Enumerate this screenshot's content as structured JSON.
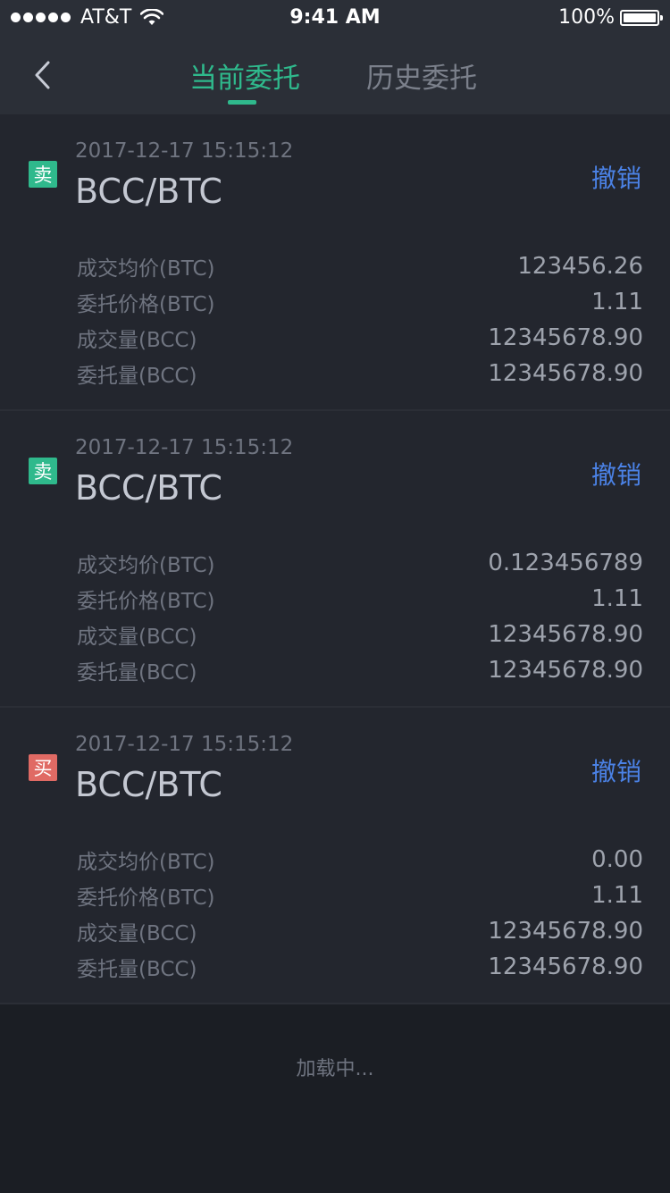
{
  "status_bar": {
    "carrier": "AT&T",
    "time": "9:41 AM",
    "battery": "100%"
  },
  "nav": {
    "back_icon": "chevron-left-icon",
    "tabs": [
      {
        "label": "当前委托",
        "active": true
      },
      {
        "label": "历史委托",
        "active": false
      }
    ]
  },
  "orders": [
    {
      "side": "卖",
      "side_color": "#2fb98c",
      "time": "2017-12-17 15:15:12",
      "pair": "BCC/BTC",
      "cancel_label": "撤销",
      "rows": [
        {
          "label": "成交均价(BTC)",
          "value": "123456.26"
        },
        {
          "label": "委托价格(BTC)",
          "value": "1.11"
        },
        {
          "label": "成交量(BCC)",
          "value": "12345678.90"
        },
        {
          "label": "委托量(BCC)",
          "value": "12345678.90"
        }
      ]
    },
    {
      "side": "卖",
      "side_color": "#2fb98c",
      "time": "2017-12-17 15:15:12",
      "pair": "BCC/BTC",
      "cancel_label": "撤销",
      "rows": [
        {
          "label": "成交均价(BTC)",
          "value": "0.123456789"
        },
        {
          "label": "委托价格(BTC)",
          "value": "1.11"
        },
        {
          "label": "成交量(BCC)",
          "value": "12345678.90"
        },
        {
          "label": "委托量(BCC)",
          "value": "12345678.90"
        }
      ]
    },
    {
      "side": "买",
      "side_color": "#e06a64",
      "time": "2017-12-17 15:15:12",
      "pair": "BCC/BTC",
      "cancel_label": "撤销",
      "rows": [
        {
          "label": "成交均价(BTC)",
          "value": "0.00"
        },
        {
          "label": "委托价格(BTC)",
          "value": "1.11"
        },
        {
          "label": "成交量(BCC)",
          "value": "12345678.90"
        },
        {
          "label": "委托量(BCC)",
          "value": "12345678.90"
        }
      ]
    }
  ],
  "loading_text": "加载中...",
  "colors": {
    "accent": "#2fb98c",
    "link": "#4b82e6",
    "buy": "#e06a64",
    "background": "#1b1e24",
    "card": "#23262e"
  }
}
